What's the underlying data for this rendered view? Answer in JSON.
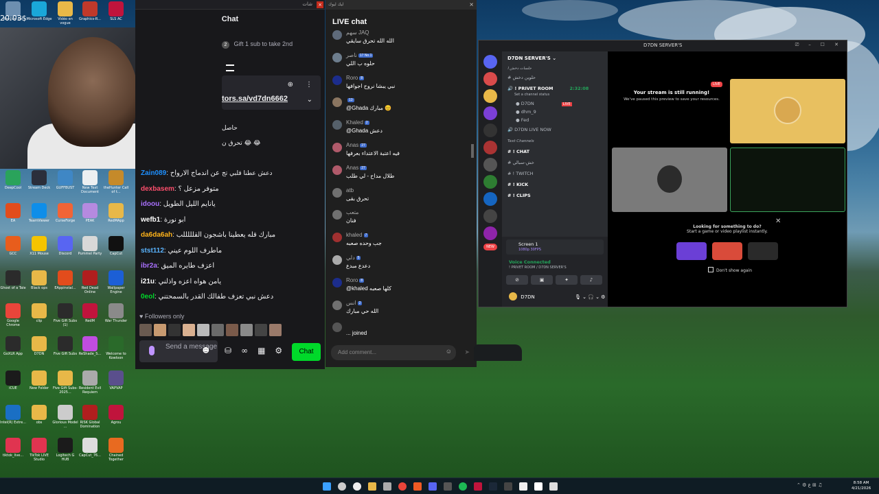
{
  "desktop": {
    "corner_clock": "20:03$",
    "icons": [
      {
        "label": "Recycle Bin",
        "color": "#6d8fb0"
      },
      {
        "label": "Microsoft Edge",
        "color": "#1aa7d9"
      },
      {
        "label": "Vidéo en vogue",
        "color": "#e8b848"
      },
      {
        "label": "Graphics-R...",
        "color": "#c0392b"
      },
      {
        "label": "SLS AC",
        "color": "#c0143c"
      },
      {
        "label": "DeepCool",
        "color": "#2aa35b"
      },
      {
        "label": "Stream Deck",
        "color": "#2b2f3b"
      },
      {
        "label": "GUFFBUST",
        "color": "#3f87c5"
      },
      {
        "label": "New Text Document",
        "color": "#eceff1"
      },
      {
        "label": "theHunter Call of t...",
        "color": "#c58a2a"
      },
      {
        "label": "EA",
        "color": "#e24c1c"
      },
      {
        "label": "TeamViewer",
        "color": "#0e8ee9"
      },
      {
        "label": "CurseForge",
        "color": "#f16436"
      },
      {
        "label": "PEAK",
        "color": "#b58ae0"
      },
      {
        "label": "RedMApp",
        "color": "#e8b848"
      },
      {
        "label": "GCC",
        "color": "#e85d1c"
      },
      {
        "label": "X11 Mouse",
        "color": "#f5c400"
      },
      {
        "label": "Discord",
        "color": "#5865f2"
      },
      {
        "label": "Pummel Party",
        "color": "#d8d8d8"
      },
      {
        "label": "CapCut",
        "color": "#111111"
      },
      {
        "label": "Ghost of a Tale",
        "color": "#2b2b2b"
      },
      {
        "label": "Black ops",
        "color": "#e8b848"
      },
      {
        "label": "EAppinstal...",
        "color": "#e24c1c"
      },
      {
        "label": "Red Dead Online",
        "color": "#b01e1e"
      },
      {
        "label": "Wallpaper Engine",
        "color": "#1c5fd6"
      },
      {
        "label": "Google Chrome",
        "color": "#e9453a"
      },
      {
        "label": "clip",
        "color": "#e8b848"
      },
      {
        "label": "Five Gift Subs (1)",
        "color": "#2b2b2b"
      },
      {
        "label": "RedM",
        "color": "#c0143c"
      },
      {
        "label": "War Thunder",
        "color": "#8a8a8a"
      },
      {
        "label": "GoXLR App",
        "color": "#2b2b2b"
      },
      {
        "label": "D7DN",
        "color": "#e8b848"
      },
      {
        "label": "Five Gift Subs",
        "color": "#2b2b2b"
      },
      {
        "label": "ReShade_S...",
        "color": "#c04de0"
      },
      {
        "label": "Welcome to Kowloon",
        "color": "#2a6a2a"
      },
      {
        "label": "iCUE",
        "color": "#1b1b1b"
      },
      {
        "label": "New Folder",
        "color": "#e8b848"
      },
      {
        "label": "Five Gift Subs-2025...",
        "color": "#e8b848"
      },
      {
        "label": "Resident Evil Requiem",
        "color": "#aaaaaa"
      },
      {
        "label": "VAPVAP",
        "color": "#5a4f8c"
      },
      {
        "label": "Intel(R) Extre...",
        "color": "#1a6fc4"
      },
      {
        "label": "obs",
        "color": "#e8b848"
      },
      {
        "label": "Glorious Model ...",
        "color": "#cccccc"
      },
      {
        "label": "RISK Global Domination",
        "color": "#b01e1e"
      },
      {
        "label": "Agrou",
        "color": "#c0143c"
      },
      {
        "label": "tiktok_live...",
        "color": "#e03450"
      },
      {
        "label": "TikTok LIVE Studio",
        "color": "#e03450"
      },
      {
        "label": "Logitech G HUB",
        "color": "#1b1b1b"
      },
      {
        "label": "CapCut_76...",
        "color": "#dddddd"
      },
      {
        "label": "Chained Together",
        "color": "#e86a20"
      }
    ]
  },
  "twitch_chat": {
    "window_title": "شات",
    "close": "×",
    "header": "Chat",
    "gift_badge": "2",
    "gift_text": "Gift 1 sub to take 2nd",
    "pinned_link": "tors.sa/vd7dn6662",
    "pin_icon": "⊕",
    "more_icon": "⋮",
    "chevron": "⌄",
    "side_lines": [
      "حاصل",
      "تحرق ن 😂 😂",
      "",
      "دعش عطنا قلبي تج"
    ],
    "messages": [
      {
        "user": "Zain089",
        "color": "#1e90ff",
        "text": "عن اندماج الارواح"
      },
      {
        "user": "dexbasem",
        "color": "#ff4f6d",
        "text": "متوفر مزعل ؟"
      },
      {
        "user": "idoou",
        "color": "#a970ff",
        "text": "يانايم الليل الطويل"
      },
      {
        "user": "wefb1",
        "color": "#ffffff",
        "text": "ابو نورة"
      },
      {
        "user": "da6da6ah",
        "color": "#ffb31a",
        "text": "مبارك قله يعطينا باشجون القلللللب"
      },
      {
        "user": "stst112",
        "color": "#5ab4ff",
        "text": "ماطرف اللوم عيني"
      },
      {
        "user": "ibr2a",
        "color": "#a970ff",
        "text": "اعزف طايره الميق"
      },
      {
        "user": "i21u",
        "color": "#ffffff",
        "text": "يامن هواه اعزه واذلني"
      },
      {
        "user": "0eol",
        "color": "#00d92a",
        "text": "دعش نبي تعزف طفالك القدر بالسمحتني"
      }
    ],
    "followers_only": "Followers only",
    "send_placeholder": "Send a message",
    "chat_button": "Chat",
    "tools": [
      "⛁",
      "∞",
      "▦",
      "⚙"
    ]
  },
  "youtube_chat": {
    "window_title": "ليك ليوك",
    "close": "×",
    "title": "LIVE chat",
    "add_comment": "Add comment...",
    "messages": [
      {
        "name": "سهم JAQ",
        "badge": "",
        "text": "الله الله تحرق سايقي",
        "av": "#5e6a7a"
      },
      {
        "name": "ناصر",
        "badge": "17 No.1",
        "text": "حلوه ب اللي",
        "av": "#6d7d8d"
      },
      {
        "name": "Roro",
        "badge": "8",
        "text": "نبي يبشا نروح اجوافها",
        "av": "#1c2d8c"
      },
      {
        "name": "",
        "badge": "13",
        "text": "@Ghada مبارك 😊",
        "av": "#8a7560"
      },
      {
        "name": "Khaled",
        "badge": "2",
        "text": "@Ghada دعش",
        "av": "#55606a"
      },
      {
        "name": "Anas",
        "badge": "27",
        "text": "فيه اعتبة الاعتداء بعرفها",
        "av": "#b05a6a"
      },
      {
        "name": "Anas",
        "badge": "27",
        "text": "طلال مداح - لي طلب",
        "av": "#b05a6a"
      },
      {
        "name": "atb",
        "badge": "",
        "text": "تحرق بقى",
        "av": "#707070"
      },
      {
        "name": "متعب",
        "badge": "",
        "text": "فنان",
        "av": "#707070"
      },
      {
        "name": "khaled",
        "badge": "7",
        "text": "جب وحده صعبه",
        "av": "#a03030"
      },
      {
        "name": "دلي",
        "badge": "5",
        "text": "دعدع مبدع",
        "av": "#aaaaaa"
      },
      {
        "name": "Roro",
        "badge": "8",
        "text": "@khaled كلها صعبه",
        "av": "#1c2d8c"
      },
      {
        "name": "انس",
        "badge": "2",
        "text": "الله حي مبارك",
        "av": "#707070"
      },
      {
        "name": "",
        "badge": "",
        "text": "... joined",
        "av": "#555555"
      }
    ]
  },
  "discord": {
    "title": "D7DN SERVER'S",
    "server_name": "D7DN SERVER'S",
    "channels": [
      {
        "label": "جلسات دخش ا",
        "type": "cat"
      },
      {
        "label": "حلوين دخش",
        "type": "text"
      },
      {
        "label": "! PRIVET ROOM",
        "type": "voice",
        "time": "2:32:08"
      },
      {
        "label": "Set a channel status",
        "type": "sub"
      },
      {
        "label": "D7DN",
        "type": "user",
        "live": "LIVE"
      },
      {
        "label": "dhm_9",
        "type": "user"
      },
      {
        "label": "Fed",
        "type": "user"
      },
      {
        "label": "D7DN LIVE NOW",
        "type": "voice"
      },
      {
        "label": "Text Channels",
        "type": "cat"
      },
      {
        "label": "! CHAT",
        "type": "text"
      },
      {
        "label": "خش-سبالي",
        "type": "text"
      },
      {
        "label": "! TWITCH",
        "type": "text"
      },
      {
        "label": "! KICK",
        "type": "text"
      },
      {
        "label": "! CLIPS",
        "type": "text"
      }
    ],
    "screen_label": "Screen 1",
    "screen_sub": "1080p 30FPS",
    "voice_connected": "Voice Connected",
    "voice_sub": "! PRIVET ROOM / D7DN SERVER'S",
    "user": "D7DN",
    "user_status": "D7DN",
    "stream_title": "Your stream is still running!",
    "stream_sub": "We've paused this preview to save your resources.",
    "live_badge": "LIVE",
    "look_title": "Looking for something to do?",
    "look_sub": "Start a game or video playlist instantly.",
    "dont_show": "Don't show again",
    "window_controls": "⎚ ⎯ ☐ ✕",
    "rail_badges": [
      "16",
      "124",
      "64"
    ],
    "new_badge": "NEW"
  },
  "taskbar": {
    "time": "8:58 AM",
    "date": "4/21/2026"
  }
}
